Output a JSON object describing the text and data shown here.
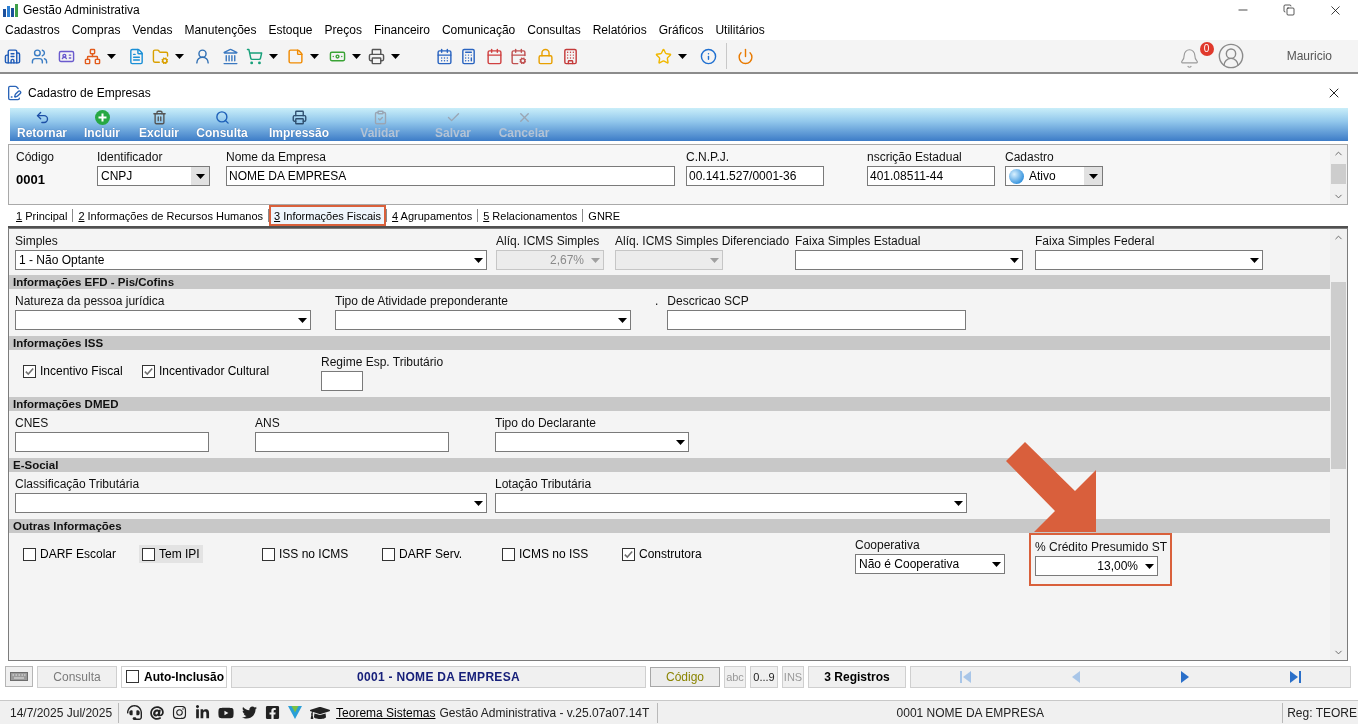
{
  "window": {
    "title": "Gestão Administrativa"
  },
  "menu": [
    "Cadastros",
    "Compras",
    "Vendas",
    "Manutenções",
    "Estoque",
    "Preços",
    "Financeiro",
    "Comunicação",
    "Consultas",
    "Relatórios",
    "Gráficos",
    "Utilitários"
  ],
  "user": {
    "notifications": "0",
    "name": "Mauricio"
  },
  "form_window": {
    "title": "Cadastro de Empresas",
    "actions": [
      {
        "label": "Retornar",
        "disabled": false
      },
      {
        "label": "Incluir",
        "disabled": false
      },
      {
        "label": "Excluir",
        "disabled": false
      },
      {
        "label": "Consulta",
        "disabled": false
      },
      {
        "label": "Impressão",
        "disabled": false
      },
      {
        "label": "Validar",
        "disabled": true
      },
      {
        "label": "Salvar",
        "disabled": true
      },
      {
        "label": "Cancelar",
        "disabled": true
      }
    ],
    "header": [
      {
        "kind": "code",
        "label": "Código",
        "value": "0001"
      },
      {
        "kind": "select",
        "label": "Identificador",
        "value": "CNPJ",
        "disabled": false
      },
      {
        "kind": "text",
        "label": "Nome da Empresa",
        "value": "NOME DA EMPRESA",
        "disabled": false
      },
      {
        "kind": "text",
        "label": "C.N.P.J.",
        "value": "00.141.527/0001-36",
        "disabled": false
      },
      {
        "kind": "text",
        "label": "nscrição Estadual",
        "value": "401.08511-44",
        "disabled": false
      },
      {
        "kind": "status-select",
        "label": "Cadastro",
        "value": "Ativo",
        "disabled": false
      }
    ],
    "tabs": [
      {
        "key": "1",
        "label": "Principal",
        "selected": false,
        "highlighted": false
      },
      {
        "key": "2",
        "label": "Informações de Recursos Humanos",
        "selected": false,
        "highlighted": false
      },
      {
        "key": "3",
        "label": "Informações Fiscais",
        "selected": true,
        "highlighted": true
      },
      {
        "key": "4",
        "label": "Agrupamentos",
        "selected": false,
        "highlighted": false
      },
      {
        "key": "5",
        "label": "Relacionamentos",
        "selected": false,
        "highlighted": false
      },
      {
        "label": "GNRE",
        "selected": false,
        "highlighted": false
      }
    ],
    "fiscal": {
      "top_fields": [
        {
          "kind": "select",
          "label": "Simples",
          "value": "1 - Não Optante",
          "disabled": false
        },
        {
          "kind": "number-select",
          "label": "Alíq. ICMS Simples",
          "value": "2,67%",
          "disabled": true
        },
        {
          "kind": "select",
          "label": "Alíq. ICMS Simples Diferenciado",
          "disabled": true
        },
        {
          "kind": "select",
          "label": "Faixa Simples Estadual",
          "disabled": false
        },
        {
          "kind": "select",
          "label": "Faixa Simples Federal",
          "disabled": false
        }
      ],
      "sections": [
        {
          "title": "Informações EFD - Pis/Cofins",
          "fields": [
            {
              "kind": "select",
              "label": "Natureza da pessoa jurídica",
              "disabled": false
            },
            {
              "kind": "select",
              "label": "Tipo de Atividade preponderante",
              "disabled": false
            },
            {
              "kind": "text",
              "label": "Descricao SCP",
              "note": ".",
              "disabled": false
            }
          ]
        },
        {
          "title": "Informações ISS",
          "fields": [
            {
              "kind": "checkbox",
              "label": "Incentivo Fiscal",
              "checked": true,
              "focused": false
            },
            {
              "kind": "checkbox",
              "label": "Incentivador Cultural",
              "checked": true,
              "focused": false
            },
            {
              "kind": "text",
              "label": "Regime Esp. Tributário",
              "disabled": false
            }
          ]
        },
        {
          "title": "Informações DMED",
          "fields": [
            {
              "kind": "text",
              "label": "CNES",
              "disabled": false
            },
            {
              "kind": "text",
              "label": "ANS",
              "disabled": false
            },
            {
              "kind": "select",
              "label": "Tipo do Declarante",
              "disabled": false
            }
          ]
        },
        {
          "title": "E-Social",
          "fields": [
            {
              "kind": "select",
              "label": "Classificação Tributária",
              "disabled": false
            },
            {
              "kind": "select",
              "label": "Lotação Tributária",
              "disabled": false
            }
          ]
        },
        {
          "title": "Outras Informações",
          "fields": [
            {
              "kind": "checkbox",
              "label": "DARF Escolar",
              "checked": false,
              "focused": false
            },
            {
              "kind": "checkbox",
              "label": "Tem IPI",
              "checked": false,
              "focused": true
            },
            {
              "kind": "checkbox",
              "label": "ISS no ICMS",
              "checked": false,
              "focused": false
            },
            {
              "kind": "checkbox",
              "label": "DARF Serv.",
              "checked": false,
              "focused": false
            },
            {
              "kind": "checkbox",
              "label": "ICMS no ISS",
              "checked": false,
              "focused": false
            },
            {
              "kind": "checkbox",
              "label": "Construtora",
              "checked": true,
              "focused": false
            },
            {
              "kind": "select",
              "label": "Cooperativa",
              "value": "Não é Cooperativa",
              "disabled": false
            },
            {
              "kind": "number-select",
              "label": "% Crédito Presumido ST",
              "value": "13,00%",
              "disabled": false,
              "highlighted": true
            }
          ]
        }
      ]
    },
    "status_bar": {
      "mode": "Consulta",
      "auto_inclusion": {
        "label": "Auto-Inclusão",
        "checked": false
      },
      "record": "0001 - NOME DA EMPRESA",
      "order": "Código",
      "indicators": [
        {
          "label": "abc",
          "active": false
        },
        {
          "label": "0...9",
          "active": true
        },
        {
          "label": "INS",
          "active": false
        }
      ],
      "count": "3 Registros",
      "navigation": [
        {
          "kind": "first",
          "disabled": true
        },
        {
          "kind": "previous",
          "disabled": true
        },
        {
          "kind": "next",
          "disabled": false
        },
        {
          "kind": "last",
          "disabled": false
        }
      ]
    }
  },
  "footer": {
    "date": "14/7/2025 Jul/2025",
    "link": "Teorema Sistemas",
    "version": "Gestão Administrativa - v.25.07a07.14T",
    "company": "0001 NOME DA EMPRESA",
    "registration": "Reg: TEORE"
  }
}
